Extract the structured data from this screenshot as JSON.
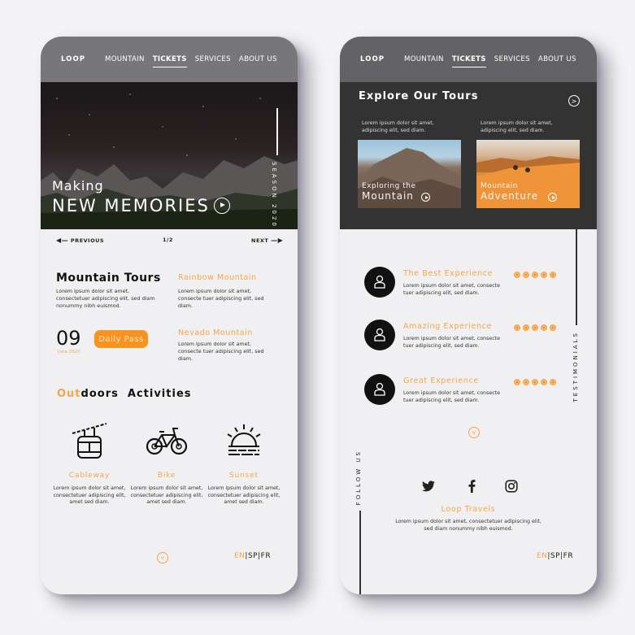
{
  "nav": {
    "logo": "LOOP",
    "items": [
      {
        "label": "MOUNTAIN",
        "active": false
      },
      {
        "label": "TICKETS",
        "active": true
      },
      {
        "label": "SERVICES",
        "active": false
      },
      {
        "label": "ABOUT US",
        "active": false
      }
    ]
  },
  "colors": {
    "accent": "#f5a64a",
    "button": "#f7931e",
    "dark": "#333333",
    "nav_left": "#77777b",
    "nav_right": "#636366",
    "background": "#f0f0f2"
  },
  "left": {
    "hero": {
      "line1": "Making",
      "line2": "NEW MEMORIES",
      "side_label": "SEASON 2020",
      "play_icon": "play-circle-icon"
    },
    "pager": {
      "previous": "PREVIOUS",
      "page": "1/2",
      "next": "NEXT"
    },
    "mountain_tours": {
      "title": "Mountain Tours",
      "desc": "Lorem ipsum dolor sit amet, consectetuer adipiscing elit, sed diam nonummy nibh euismod."
    },
    "rainbow": {
      "title": "Rainbow Mountain",
      "desc": "Lorem ipsum dolor sit amet, consecte tuer adipiscing elit, sed diam."
    },
    "date": {
      "day": "09",
      "month": "June 2020"
    },
    "daily_pass": "Daily Pass",
    "nevado": {
      "title": "Nevado Mountain",
      "desc": "Lorem ipsum dolor sit amet, consecte tuer adipiscing elit, sed diam."
    },
    "outdoors": {
      "accent": "Out",
      "rest": "doors  Activities"
    },
    "activities": [
      {
        "label": "Cableway",
        "icon": "cable-car-icon",
        "desc": "Lorem ipsum dolor sit amet, consectetuer adipiscing elit, amet sed diam."
      },
      {
        "label": "Bike",
        "icon": "bicycle-icon",
        "desc": "Lorem ipsum dolor sit amet, consectetuer adipiscing elit, amet sed diam."
      },
      {
        "label": "Sunset",
        "icon": "sunset-icon",
        "desc": "Lorem ipsum dolor sit amet, consectetuer adipiscing elit, amet sed diam."
      }
    ],
    "lang": {
      "en": "EN",
      "sp": "SP",
      "fr": "FR",
      "sep": "|"
    }
  },
  "right": {
    "explore": {
      "title": "Explore Our Tours",
      "left_desc": "Lorem ipsum dolor sit amet, adipiscing elit, sed diam.",
      "right_desc": "Lorem ipsum dolor sit amet, adipiscing elit, sed diam.",
      "cards": [
        {
          "line1": "Exploring the",
          "line2": "Mountain"
        },
        {
          "line1": "Mountain",
          "line2": "Adventure"
        }
      ]
    },
    "testimonials_label": "TESTIMONIALS",
    "reviews": [
      {
        "title": "The Best Experience",
        "desc_1": "Lorem ipsum dolor sit amet, consecte",
        "desc_2": "tuer adipiscing elit, sed diam.",
        "rating": 5
      },
      {
        "title": "Amazing Experience",
        "desc_1": "Lorem ipsum dolor sit amet, consecte",
        "desc_2": "tuer adipiscing elit, sed diam.",
        "rating": 5
      },
      {
        "title": "Great Experience",
        "desc_1": "Lorem ipsum dolor sit amet, consecte",
        "desc_2": "tuer adipiscing elit, sed diam.",
        "rating": 5
      }
    ],
    "follow_label": "FOLLOW US",
    "social": [
      "twitter-icon",
      "facebook-icon",
      "instagram-icon"
    ],
    "footer": {
      "title": "Loop Travels",
      "desc_1": "Lorem ipsum dolor sit amet, consectetuer adipiscing elit,",
      "desc_2": "sed diam nonummy nibh euismod."
    },
    "lang": {
      "en": "EN",
      "sp": "SP",
      "fr": "FR",
      "sep": "|"
    }
  }
}
